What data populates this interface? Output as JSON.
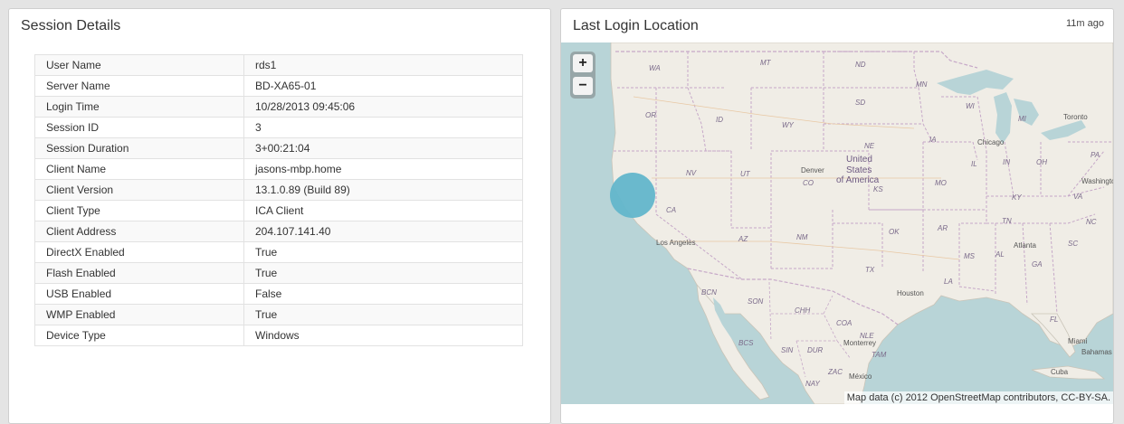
{
  "session_panel": {
    "title": "Session Details",
    "rows": [
      {
        "label": "User Name",
        "value": "rds1"
      },
      {
        "label": "Server Name",
        "value": "BD-XA65-01"
      },
      {
        "label": "Login Time",
        "value": "10/28/2013 09:45:06"
      },
      {
        "label": "Session ID",
        "value": "3"
      },
      {
        "label": "Session Duration",
        "value": "3+00:21:04"
      },
      {
        "label": "Client Name",
        "value": "jasons-mbp.home"
      },
      {
        "label": "Client Version",
        "value": "13.1.0.89 (Build 89)"
      },
      {
        "label": "Client Type",
        "value": "ICA Client"
      },
      {
        "label": "Client Address",
        "value": "204.107.141.40"
      },
      {
        "label": "DirectX Enabled",
        "value": "True"
      },
      {
        "label": "Flash Enabled",
        "value": "True"
      },
      {
        "label": "USB Enabled",
        "value": "False"
      },
      {
        "label": "WMP Enabled",
        "value": "True"
      },
      {
        "label": "Device Type",
        "value": "Windows"
      }
    ]
  },
  "map_panel": {
    "title": "Last Login Location",
    "timestamp": "11m ago",
    "zoom_in_label": "+",
    "zoom_out_label": "−",
    "attribution": "Map data (c) 2012 OpenStreetMap contributors, CC-BY-SA.",
    "colors": {
      "land": "#f0ede6",
      "ocean": "#b8d4d7",
      "border": "#c6a8c8",
      "marker": "#62b6cb"
    },
    "labels": {
      "wa": "WA",
      "mt": "MT",
      "nd": "ND",
      "mn": "MN",
      "or": "OR",
      "id": "ID",
      "sd": "SD",
      "wi": "WI",
      "mi": "MI",
      "toronto": "Toronto",
      "wy": "WY",
      "ne": "NE",
      "ia": "IA",
      "chicago": "Chicago",
      "pa": "PA",
      "united": "United",
      "states": "States",
      "of_america": "of America",
      "denver": "Denver",
      "co": "CO",
      "ks": "KS",
      "nv": "NV",
      "ut": "UT",
      "il": "IL",
      "in": "IN",
      "oh": "OH",
      "mo": "MO",
      "ky": "KY",
      "washington": "Washington",
      "va": "VA",
      "ca": "CA",
      "tn": "TN",
      "nc": "NC",
      "los_angeles": "Los Angeles",
      "az": "AZ",
      "nm": "NM",
      "ok": "OK",
      "ar": "AR",
      "atlanta": "Atlanta",
      "ms": "MS",
      "al": "AL",
      "ga": "GA",
      "sc": "SC",
      "tx": "TX",
      "la": "LA",
      "houston": "Houston",
      "bcn": "BCN",
      "son": "SON",
      "chh": "CHH",
      "fl": "FL",
      "coa": "COA",
      "nle": "NLE",
      "monterrey": "Monterrey",
      "bcs": "BCS",
      "sin": "SIN",
      "dur": "DUR",
      "tam": "TAM",
      "miami": "Miami",
      "bahamas": "Bahamas",
      "zac": "ZAC",
      "mexico": "México",
      "cuba": "Cuba",
      "nay": "NAY"
    }
  }
}
